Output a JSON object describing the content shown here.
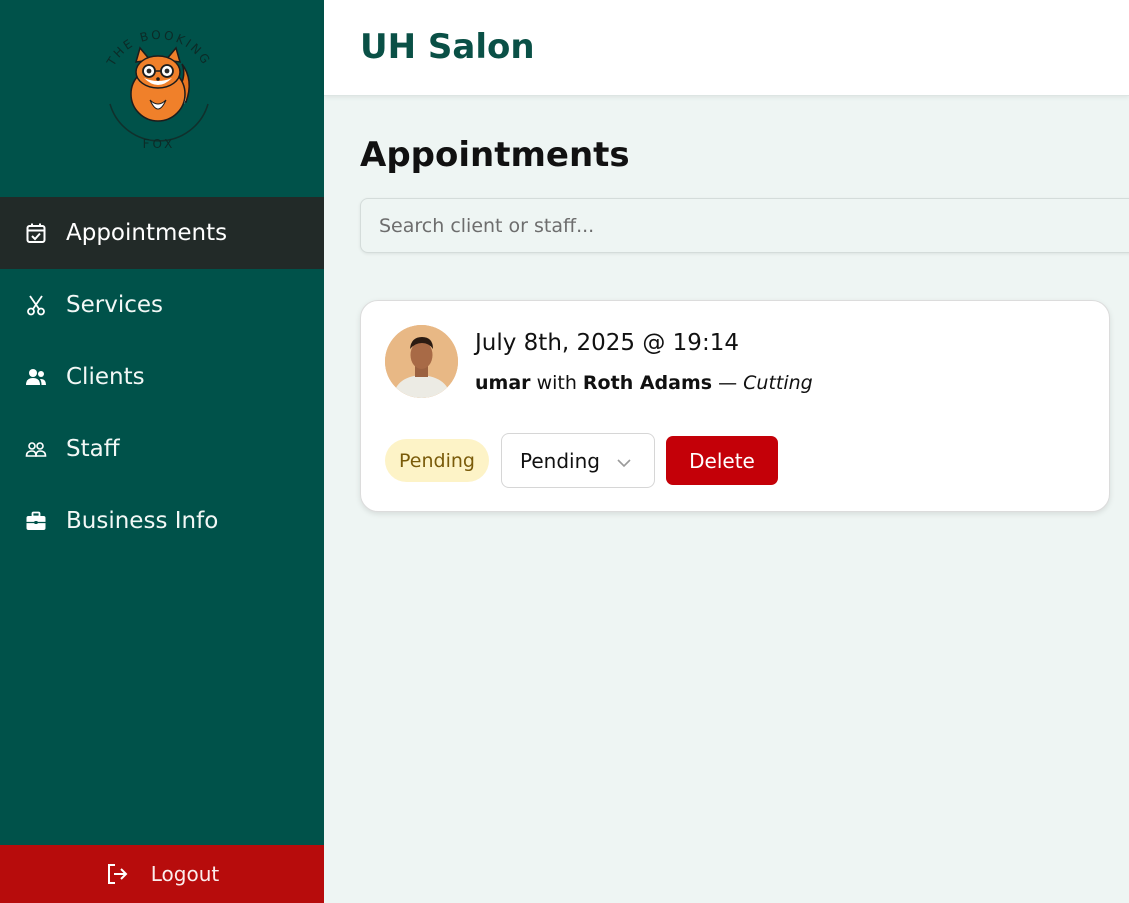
{
  "brand": {
    "logo_top_text": "THE BOOKING",
    "logo_bottom_text": "FOX"
  },
  "sidebar": {
    "items": [
      {
        "label": "Appointments",
        "icon": "calendar-check-icon",
        "active": true
      },
      {
        "label": "Services",
        "icon": "scissors-icon",
        "active": false
      },
      {
        "label": "Clients",
        "icon": "users-icon",
        "active": false
      },
      {
        "label": "Staff",
        "icon": "staff-icon",
        "active": false
      },
      {
        "label": "Business Info",
        "icon": "briefcase-icon",
        "active": false
      }
    ],
    "logout_label": "Logout",
    "logout_icon": "logout-icon"
  },
  "header": {
    "salon_name": "UH Salon"
  },
  "main": {
    "title": "Appointments",
    "search_placeholder": "Search client or staff...",
    "appointments": [
      {
        "datetime": "July 8th, 2025 @ 19:14",
        "client": "umar",
        "with_text": "with",
        "staff": "Roth Adams",
        "separator": "—",
        "service": "Cutting",
        "status_badge": "Pending",
        "status_select_value": "Pending",
        "delete_label": "Delete"
      }
    ]
  },
  "colors": {
    "sidebar_bg": "#00524a",
    "active_item_bg": "#222a28",
    "logout_bg": "#b70c0c",
    "brand_text": "#0a5046",
    "delete_bg": "#c40008",
    "badge_bg": "#fdf3c7",
    "page_bg": "#eef5f3"
  }
}
